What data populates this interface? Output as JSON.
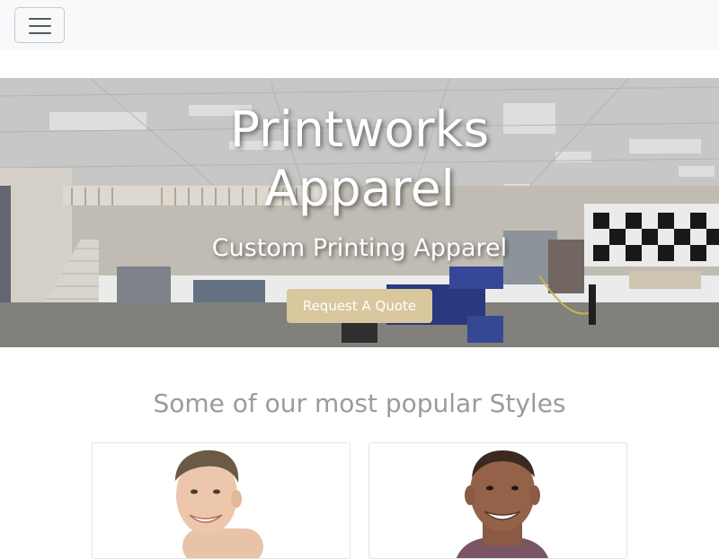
{
  "navbar": {
    "toggler_icon": "hamburger-menu-icon"
  },
  "hero": {
    "title_line1": "Printworks",
    "title_line2": "Apparel",
    "subtitle": "Custom Printing Apparel",
    "cta_label": "Request A Quote",
    "cta_color": "#d9c79d"
  },
  "styles_section": {
    "heading": "Some of our most popular Styles",
    "cards": [
      {
        "image": "model-photo-man-light-hair"
      },
      {
        "image": "model-photo-man-shaved-head"
      }
    ]
  }
}
